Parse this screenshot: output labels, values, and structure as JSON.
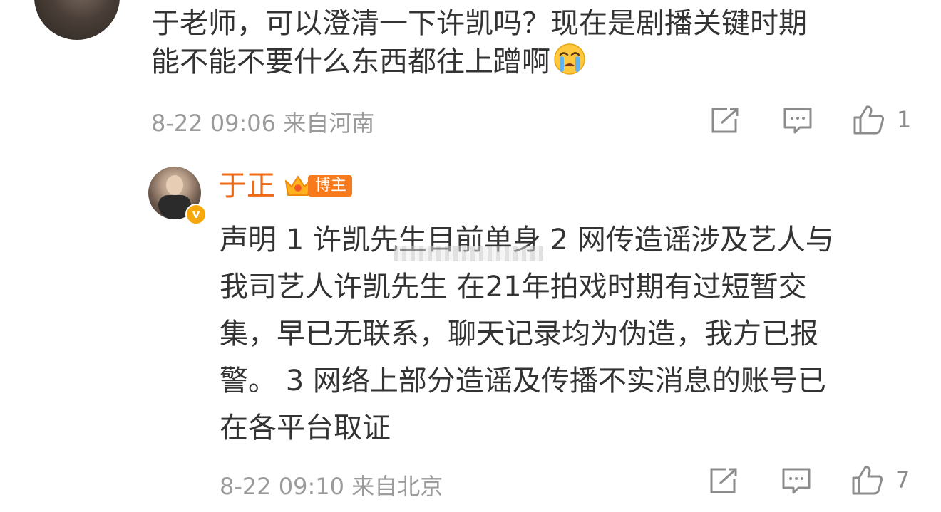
{
  "comment": {
    "text": "于老师，可以澄清一下许凯吗？现在是剧播关键时期\n能不能不要什么东西都往上蹭啊",
    "emoji": "crying-face",
    "time": "8-22 09:06",
    "location": "来自河南",
    "like_count": "1"
  },
  "reply": {
    "author": "于正",
    "badge": "博主",
    "verified_mark": "v",
    "text": "声明 1 许凯先生目前单身 2 网传造谣涉及艺人与\n我司艺人许凯先生 在21年拍戏时期有过短暂交\n集，早已无联系，聊天记录均为伪造，我方已报\n警。 3 网络上部分造谣及传播不实消息的账号已\n在各平台取证",
    "time": "8-22 09:10",
    "location": "来自北京",
    "like_count": "7"
  },
  "colors": {
    "name_orange": "#f06a16",
    "badge_orange": "#f77a1c",
    "meta_gray": "#9b9b9b",
    "text": "#333333"
  }
}
